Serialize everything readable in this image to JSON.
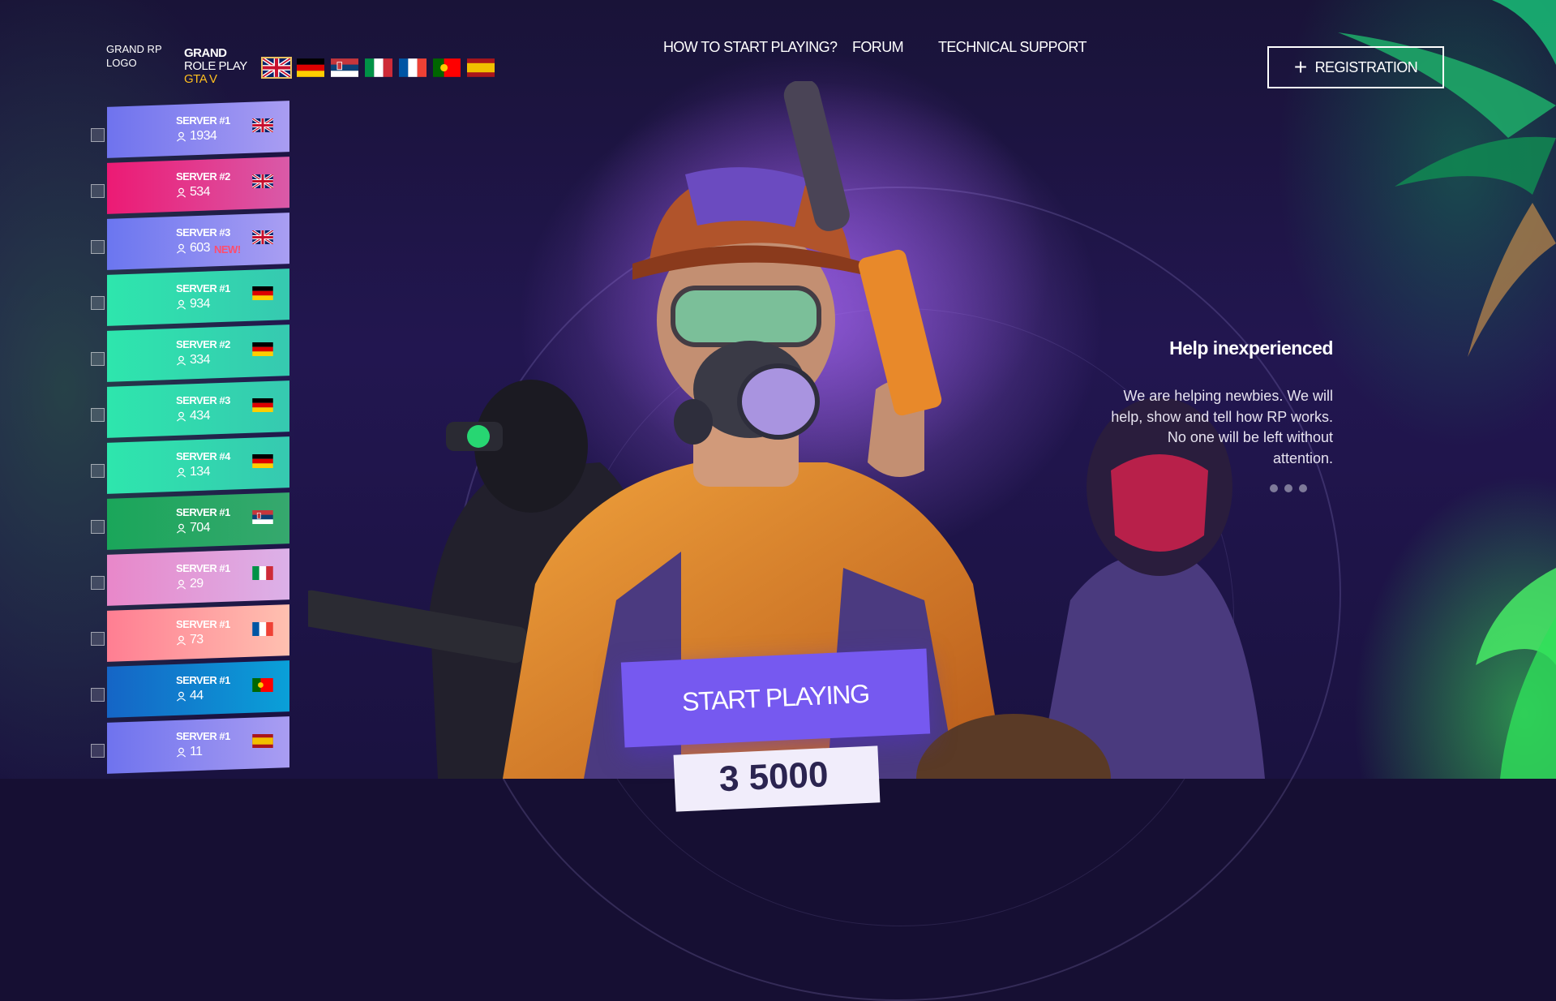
{
  "header": {
    "logo_alt": "GRAND RP LOGO",
    "brand_line1": "GRAND",
    "brand_line2": "ROLE PLAY",
    "brand_line3": "GTA V",
    "languages": [
      {
        "code": "en",
        "icon": "uk-flag-icon",
        "active": true
      },
      {
        "code": "de",
        "icon": "germany-flag-icon"
      },
      {
        "code": "rs",
        "icon": "serbia-flag-icon"
      },
      {
        "code": "it",
        "icon": "italy-flag-icon"
      },
      {
        "code": "fr",
        "icon": "france-flag-icon"
      },
      {
        "code": "pt",
        "icon": "portugal-flag-icon"
      },
      {
        "code": "es",
        "icon": "spain-flag-icon"
      }
    ],
    "nav": [
      {
        "label": "HOW TO START PLAYING?"
      },
      {
        "label": "FORUM"
      },
      {
        "label": "TECHNICAL SUPPORT"
      }
    ],
    "register_label": "REGISTRATION"
  },
  "servers": [
    {
      "name": "SERVER #1",
      "players": "1934",
      "flag": "uk-flag-icon",
      "colors": [
        "#6f73ee",
        "#a99df2"
      ]
    },
    {
      "name": "SERVER #2",
      "players": "534",
      "flag": "uk-flag-icon",
      "colors": [
        "#ec1a74",
        "#d95aa8"
      ]
    },
    {
      "name": "SERVER #3",
      "players": "603",
      "badge": "NEW!",
      "flag": "uk-flag-icon",
      "colors": [
        "#6b76f0",
        "#a99ef2"
      ]
    },
    {
      "name": "SERVER #1",
      "players": "934",
      "flag": "germany-flag-icon",
      "colors": [
        "#2ee6ad",
        "#36c9b0"
      ]
    },
    {
      "name": "SERVER #2",
      "players": "334",
      "flag": "germany-flag-icon",
      "colors": [
        "#2ee6ad",
        "#36c9b0"
      ]
    },
    {
      "name": "SERVER #3",
      "players": "434",
      "flag": "germany-flag-icon",
      "colors": [
        "#2ee6ad",
        "#36c9b0"
      ]
    },
    {
      "name": "SERVER #4",
      "players": "134",
      "flag": "germany-flag-icon",
      "colors": [
        "#2ee6ad",
        "#36c9b0"
      ]
    },
    {
      "name": "SERVER #1",
      "players": "704",
      "flag": "serbia-flag-icon",
      "colors": [
        "#1aa65a",
        "#36a86e"
      ]
    },
    {
      "name": "SERVER #1",
      "players": "29",
      "flag": "italy-flag-icon",
      "colors": [
        "#e887c9",
        "#dcb1e8"
      ]
    },
    {
      "name": "SERVER #1",
      "players": "73",
      "flag": "france-flag-icon",
      "colors": [
        "#ff7e92",
        "#ffc0b0"
      ]
    },
    {
      "name": "SERVER #1",
      "players": "44",
      "flag": "portugal-flag-icon",
      "colors": [
        "#1565c6",
        "#0aa0d8"
      ]
    },
    {
      "name": "SERVER #1",
      "players": "11",
      "flag": "spain-flag-icon",
      "colors": [
        "#6f73ee",
        "#a99df2"
      ]
    }
  ],
  "slide": {
    "title": "Help inexperienced",
    "text": "We are helping newbies. We will help, show and tell how RP works. No one will be left without attention.",
    "dots": 3
  },
  "cta": {
    "start_label": "START PLAYING",
    "online_partial": "3 5000"
  }
}
